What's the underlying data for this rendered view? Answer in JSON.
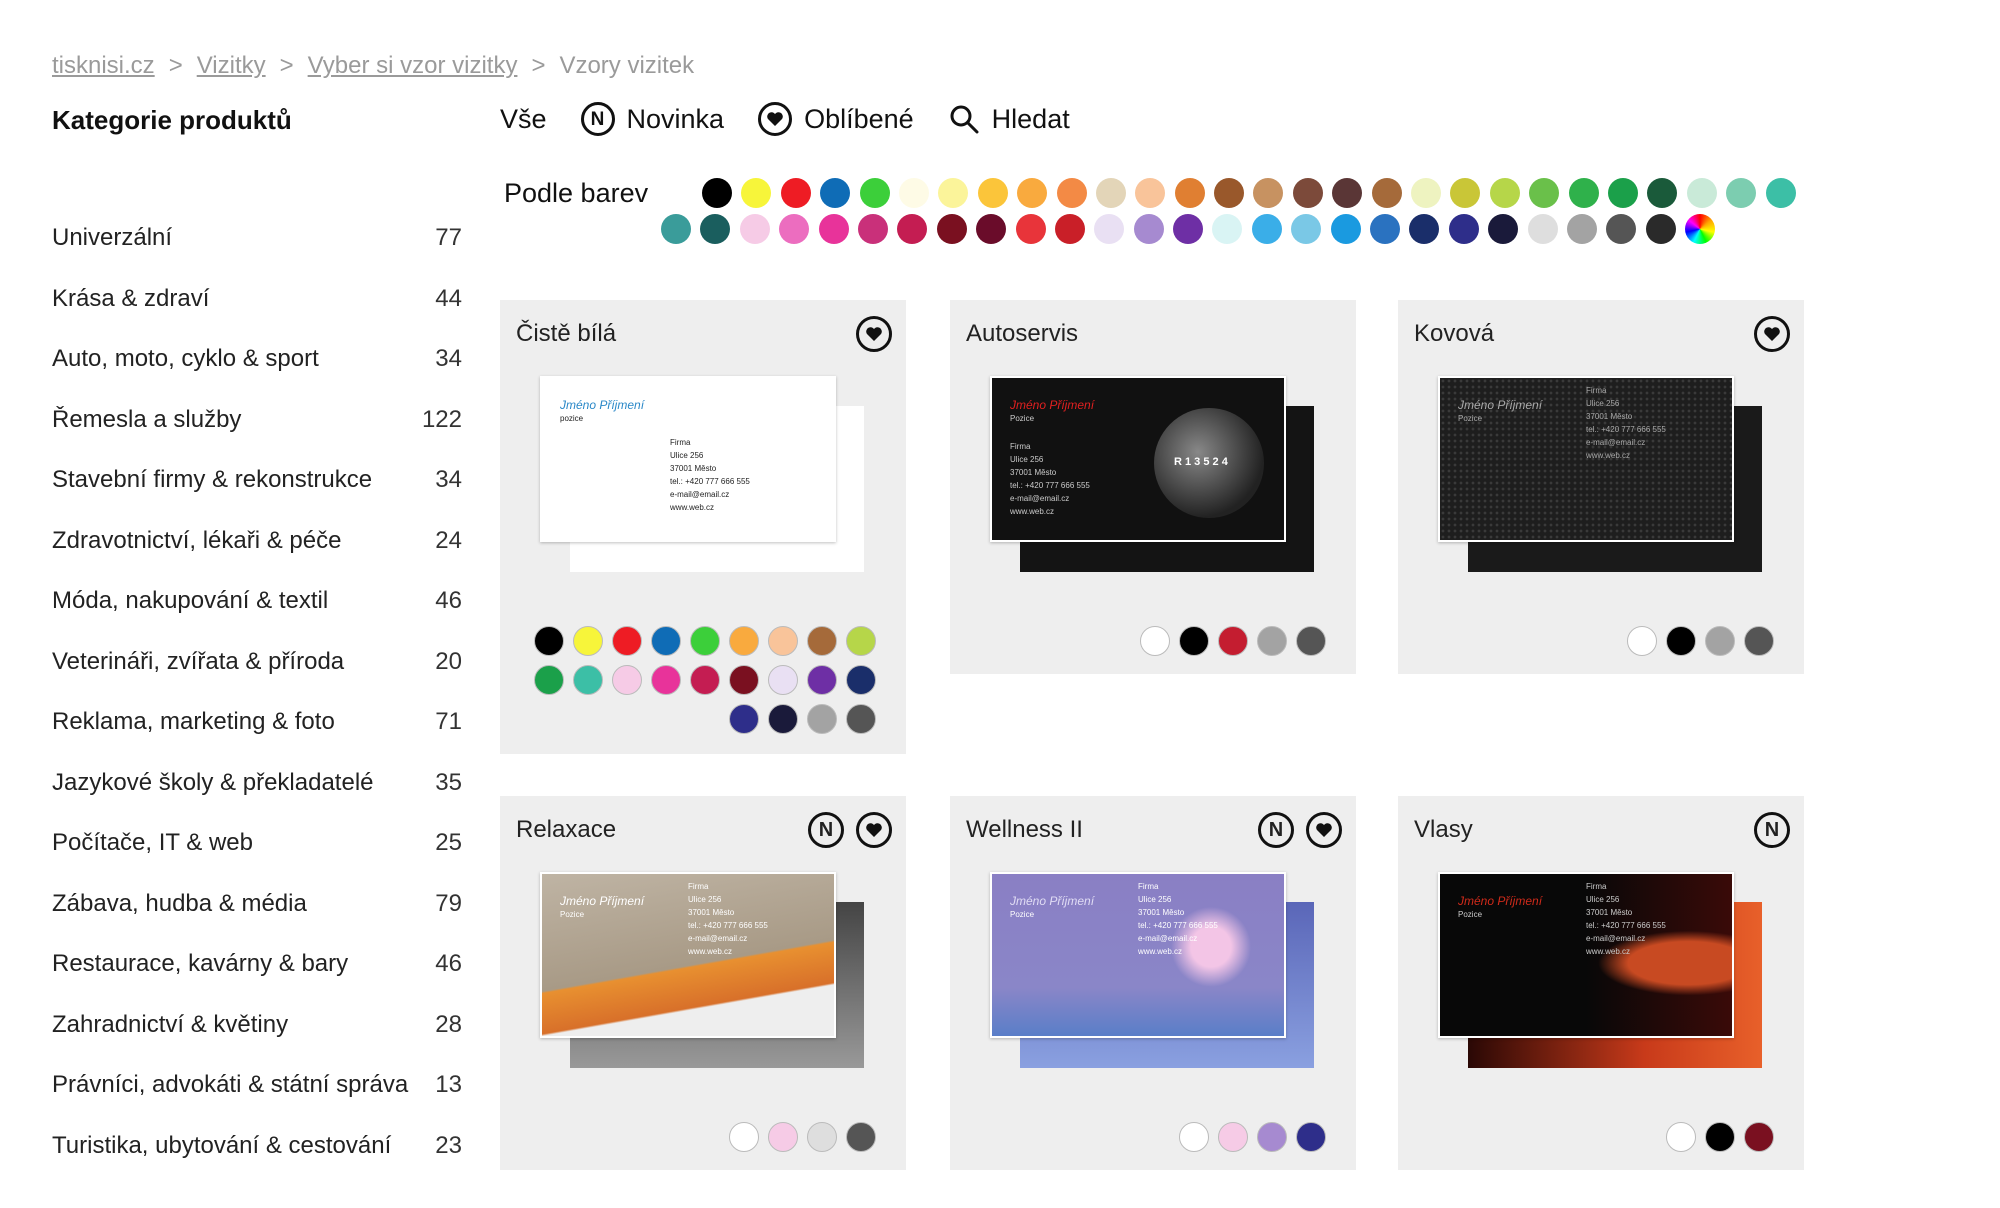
{
  "breadcrumb": [
    {
      "label": "tisknisi.cz",
      "link": true
    },
    {
      "label": "Vizitky",
      "link": true
    },
    {
      "label": "Vyber si vzor vizitky",
      "link": true
    },
    {
      "label": "Vzory vizitek",
      "link": false
    }
  ],
  "sidebar": {
    "title": "Kategorie produktů",
    "items": [
      {
        "label": "Univerzální",
        "count": "77"
      },
      {
        "label": "Krása & zdraví",
        "count": "44"
      },
      {
        "label": "Auto, moto, cyklo & sport",
        "count": "34"
      },
      {
        "label": "Řemesla a služby",
        "count": "122"
      },
      {
        "label": "Stavební firmy & rekonstrukce",
        "count": "34"
      },
      {
        "label": "Zdravotnictví, lékaři & péče",
        "count": "24"
      },
      {
        "label": "Móda, nakupování & textil",
        "count": "46"
      },
      {
        "label": "Veterináři, zvířata & příroda",
        "count": "20"
      },
      {
        "label": "Reklama, marketing & foto",
        "count": "71"
      },
      {
        "label": "Jazykové školy & překladatelé",
        "count": "35"
      },
      {
        "label": "Počítače, IT & web",
        "count": "25"
      },
      {
        "label": "Zábava, hudba & média",
        "count": "79"
      },
      {
        "label": "Restaurace, kavárny & bary",
        "count": "46"
      },
      {
        "label": "Zahradnictví & květiny",
        "count": "28"
      },
      {
        "label": "Právníci, advokáti & státní správa",
        "count": "13"
      },
      {
        "label": "Turistika, ubytování & cestování",
        "count": "23"
      }
    ]
  },
  "filters": {
    "all": "Vše",
    "new": "Novinka",
    "new_icon_letter": "N",
    "favorite": "Oblíbené",
    "search": "Hledat"
  },
  "colors_label": "Podle barev",
  "color_rows": [
    [
      "#000000",
      "#f7f53a",
      "#ee1c24",
      "#0f6cb6",
      "#3ccf3a",
      "#fefbe6",
      "#fbf49a",
      "#fbc53a",
      "#f9aa3e",
      "#f38a45",
      "#e3d5b8",
      "#f9c49a",
      "#e07f32",
      "#99582b",
      "#c79261",
      "#7c4a3a",
      "#5a3636",
      "#a56a3a",
      "#eef3c0",
      "#c9c637",
      "#b6d649",
      "#6ac04a",
      "#2fb14b",
      "#1ba04a",
      "#1a5a3a",
      "#c9ead8",
      "#7ccdb0",
      "#3cbfa6"
    ],
    [
      "#3a9c9a",
      "#1a5e5e",
      "#f6cbe6",
      "#ec6dbf",
      "#e8339a",
      "#c9307a",
      "#c41d52",
      "#7a1020",
      "#6a0c2a",
      "#e8343a",
      "#c91f28",
      "#e9e0f3",
      "#a68ad0",
      "#6e2fa5",
      "#d9f4f4",
      "#3aaee8",
      "#7ac8e6",
      "#1a9ae0",
      "#2a72c0",
      "#1a2e6a",
      "#2e2e8a",
      "#1a1a3a",
      "#dedede",
      "#a3a3a3",
      "#555555",
      "#2a2a2a",
      "rainbow"
    ]
  ],
  "new_badge": "N",
  "cards": [
    {
      "title": "Čistě bílá",
      "badges": [
        "favorite"
      ],
      "front_bg": "#ffffff",
      "back_bg": "#ffffff",
      "name": "Jméno Příjmení",
      "name_color": "#2a88c8",
      "position": "pozice",
      "info": "Firma\nUlice 256\n37001 Město\ntel.: +420 777 666 555\ne-mail@email.cz\nwww.web.cz",
      "text_color": "#222",
      "swatches": [
        [
          "#000000",
          "#f7f53a",
          "#ee1c24",
          "#0f6cb6",
          "#3ccf3a",
          "#f9aa3e",
          "#f9c49a",
          "#a56a3a",
          "#b6d649"
        ],
        [
          "#1ba04a",
          "#3cbfa6",
          "#f6cbe6",
          "#e8339a",
          "#c41d52",
          "#7a1020",
          "#e9e0f3",
          "#6e2fa5",
          "#1a2e6a"
        ],
        [
          "#2e2e8a",
          "#1a1a3a",
          "#a3a3a3",
          "#555555"
        ]
      ]
    },
    {
      "title": "Autoservis",
      "badges": [],
      "front_bg": "#111111",
      "back_bg": "#141414",
      "name": "Jméno Příjmení",
      "name_color": "#e02020",
      "position": "Pozice",
      "info": "Firma\nUlice 256\n37001 Město\ntel.: +420 777 666 555\ne-mail@email.cz\nwww.web.cz",
      "text_color": "#cccccc",
      "gear_text": "R 1 3 5 2 4",
      "swatches": [
        [
          "#ffffff",
          "#000000",
          "#c41d30",
          "#a3a3a3",
          "#555555"
        ]
      ]
    },
    {
      "title": "Kovová",
      "badges": [
        "favorite"
      ],
      "front_bg": "#1e1e1e",
      "back_bg": "#1a1a1a",
      "name": "Jméno Příjmení",
      "name_color": "#aaaaaa",
      "position": "Pozice",
      "info": "Firma\nUlice 256\n37001 Město\ntel.: +420 777 666 555\ne-mail@email.cz\nwww.web.cz",
      "text_color": "#aaaaaa",
      "swatches": [
        [
          "#ffffff",
          "#000000",
          "#a3a3a3",
          "#555555"
        ]
      ]
    },
    {
      "title": "Relaxace",
      "badges": [
        "new",
        "favorite"
      ],
      "front_bg": "#b7ab9b",
      "back_bg": "#3a3a3a",
      "name": "Jméno Příjmení",
      "name_color": "#ffffff",
      "position": "Pozice",
      "info": "Firma\nUlice 256\n37001 Město\ntel.: +420 777 666 555\ne-mail@email.cz\nwww.web.cz",
      "text_color": "#ffffff",
      "swatches": [
        [
          "#ffffff",
          "#f6cbe6",
          "#dedede",
          "#555555"
        ]
      ]
    },
    {
      "title": "Wellness II",
      "badges": [
        "new",
        "favorite"
      ],
      "front_bg": "#8a7fc4",
      "back_bg": "#5a66b8",
      "name": "Jméno Příjmení",
      "name_color": "#e0dcf4",
      "position": "Pozice",
      "info": "Firma\nUlice 256\n37001 Město\ntel.: +420 777 666 555\ne-mail@email.cz\nwww.web.cz",
      "text_color": "#ffffff",
      "swatches": [
        [
          "#ffffff",
          "#f6cbe6",
          "#a68ad0",
          "#2e2e8a"
        ]
      ]
    },
    {
      "title": "Vlasy",
      "badges": [
        "new"
      ],
      "front_bg": "#080808",
      "back_bg": "#a0281a",
      "name": "Jméno Příjmení",
      "name_color": "#d02a1a",
      "position": "Pozice",
      "info": "Firma\nUlice 256\n37001 Město\ntel.: +420 777 666 555\ne-mail@email.cz\nwww.web.cz",
      "text_color": "#cccccc",
      "swatches": [
        [
          "#ffffff",
          "#000000",
          "#7a1020"
        ]
      ]
    }
  ]
}
